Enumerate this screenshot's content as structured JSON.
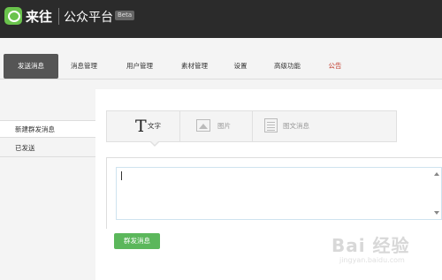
{
  "header": {
    "brand": "来往",
    "platform": "公众平台",
    "badge": "Beta"
  },
  "nav": {
    "items": [
      {
        "label": "发送消息",
        "active": true
      },
      {
        "label": "消息管理"
      },
      {
        "label": "用户管理"
      },
      {
        "label": "素材管理"
      },
      {
        "label": "设置"
      },
      {
        "label": "高级功能"
      },
      {
        "label": "公告",
        "color": "#c0392b"
      }
    ]
  },
  "sidebar": {
    "items": [
      {
        "label": "新建群发消息",
        "active": true
      },
      {
        "label": "已发送"
      }
    ]
  },
  "compose": {
    "tabs": [
      {
        "label": "文字",
        "icon": "text-T-icon",
        "active": true
      },
      {
        "label": "图片",
        "icon": "image-icon"
      },
      {
        "label": "图文消息",
        "icon": "news-icon"
      }
    ],
    "text_value": "",
    "send_label": "群发消息"
  },
  "watermark": {
    "text": "Bai 经验",
    "sub": "jingyan.baidu.com"
  },
  "colors": {
    "topbar": "#2b2b2b",
    "brand_green": "#6ac34c",
    "send_button": "#5bb75b",
    "nav_active": "#555555"
  }
}
